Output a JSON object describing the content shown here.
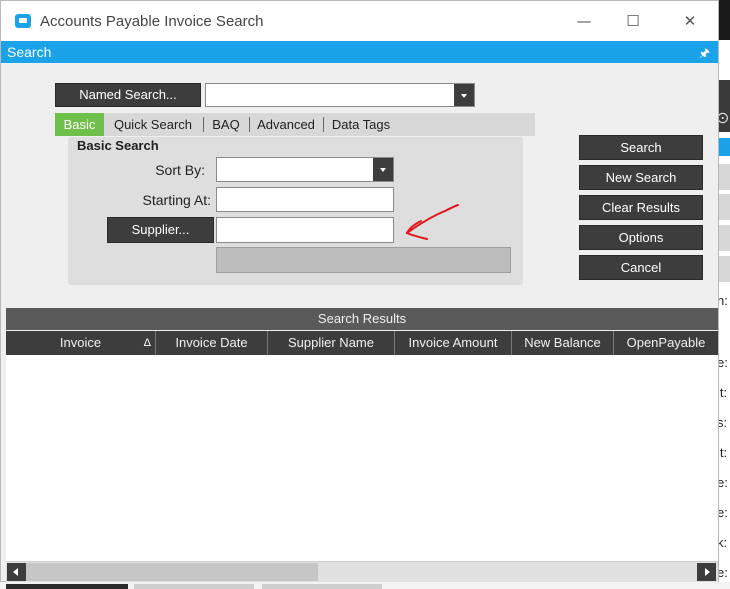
{
  "window": {
    "title": "Accounts Payable Invoice Search",
    "minimize": "—",
    "maximize": "☐",
    "close": "✕"
  },
  "panel": {
    "title": "Search",
    "pin": "🖈"
  },
  "named_search": {
    "button_label": "Named Search...",
    "value": ""
  },
  "tabs": [
    "Basic",
    "Quick Search",
    "BAQ",
    "Advanced",
    "Data Tags"
  ],
  "basic_search": {
    "group_title": "Basic Search",
    "sort_by_label": "Sort By:",
    "sort_by_value": "",
    "starting_at_label": "Starting At:",
    "starting_at_value": "",
    "supplier_button": "Supplier...",
    "supplier_value": ""
  },
  "actions": {
    "search": "Search",
    "new_search": "New Search",
    "clear_results": "Clear Results",
    "options": "Options",
    "cancel": "Cancel"
  },
  "results": {
    "title": "Search Results",
    "sort_indicator": "Δ",
    "columns": [
      "Invoice",
      "Invoice Date",
      "Supplier Name",
      "Invoice Amount",
      "New Balance",
      "OpenPayable"
    ]
  },
  "background_labels": [
    "n:",
    "e:",
    "it:",
    "s:",
    "it:",
    "e:",
    "e:",
    "k:",
    "e:"
  ],
  "colors": {
    "accent": "#1aa3e8",
    "active_tab": "#6fc04a",
    "button_dark": "#3d3d3d",
    "annotation": "#e0161b"
  }
}
